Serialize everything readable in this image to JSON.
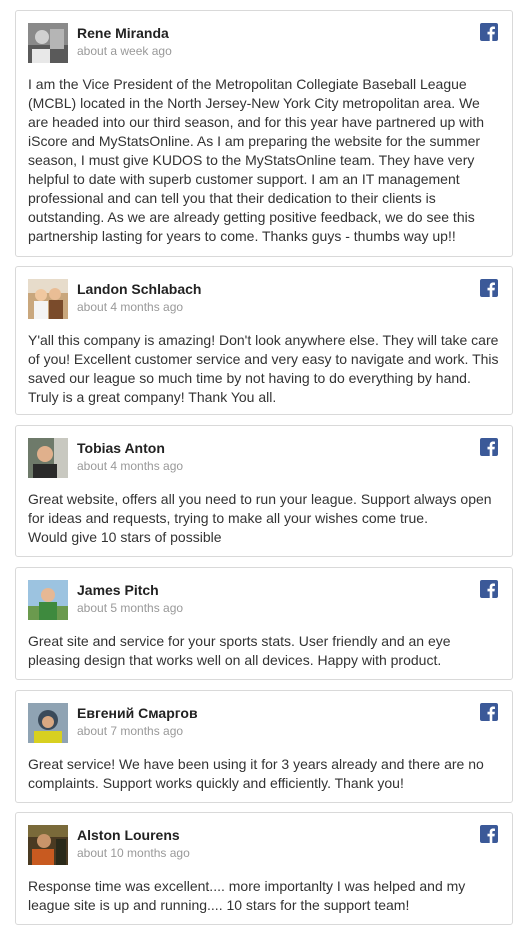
{
  "colors": {
    "facebook_blue": "#3b5998",
    "author_text": "#222222",
    "time_text": "#999999",
    "card_border": "#d9d9d9"
  },
  "icons": {
    "platform": "facebook-icon"
  },
  "reviews": [
    {
      "author": "Rene Miranda",
      "time": "about a week ago",
      "text": "I am the Vice President of the Metropolitan Collegiate Baseball League (MCBL) located in the North Jersey-New York City metropolitan area. We are headed into our third season, and for this year have partnered up with iScore and MyStatsOnline. As I am preparing the website for the summer season, I must give KUDOS to the MyStatsOnline team. They have very helpful to date with superb customer support. I am an IT management professional and can tell you that their dedication to their clients is outstanding. As we are already getting positive feedback, we do see this partnership lasting for years to come. Thanks guys - thumbs way up!!"
    },
    {
      "author": "Landon Schlabach",
      "time": "about 4 months ago",
      "text": "Y'all this company is amazing! Don't look anywhere else. They will take care of you! Excellent customer service and very easy to navigate and work. This saved our league so much time by not having to do everything by hand. Truly is a great company! Thank You all."
    },
    {
      "author": "Tobias Anton",
      "time": "about 4 months ago",
      "text": "Great website, offers all you need to run your league. Support always open for ideas and requests, trying to make all your wishes come true.\nWould give 10 stars of possible"
    },
    {
      "author": "James Pitch",
      "time": "about 5 months ago",
      "text": "Great site and service for your sports stats. User friendly and an eye pleasing design that works well on all devices. Happy with product."
    },
    {
      "author": "Евгений Смаргов",
      "time": "about 7 months ago",
      "text": "Great service! We have been using it for 3 years already and there are no complaints. Support works quickly and efficiently. Thank you!"
    },
    {
      "author": "Alston Lourens",
      "time": "about 10 months ago",
      "text": "Response time was excellent.... more importanlty I was helped and my league site is up and running.... 10 stars for the support team!"
    }
  ]
}
